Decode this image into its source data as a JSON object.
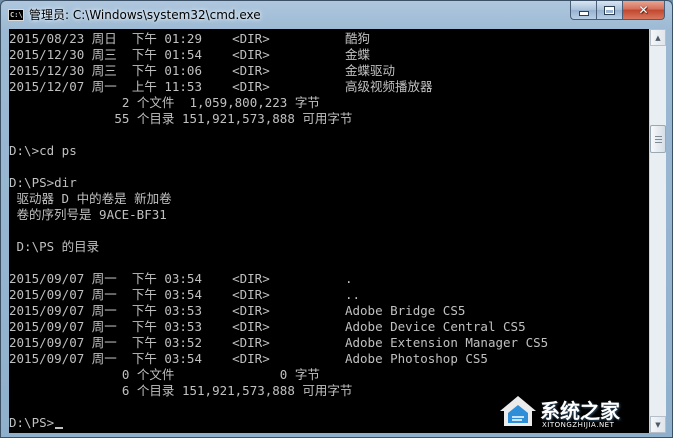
{
  "window": {
    "title": "管理员: C:\\Windows\\system32\\cmd.exe",
    "icon_label": "C:\\",
    "buttons": {
      "minimize": "minimize-icon",
      "maximize": "maximize-icon",
      "close": "close-icon",
      "close_glyph": "✕"
    }
  },
  "console": {
    "lines": [
      "2015/08/23 周日  下午 01:29    <DIR>          酷狗",
      "2015/12/30 周三  下午 01:54    <DIR>          金蝶",
      "2015/12/30 周三  下午 01:06    <DIR>          金蝶驱动",
      "2015/12/07 周一  上午 11:53    <DIR>          高级视频播放器",
      "               2 个文件  1,059,800,223 字节",
      "              55 个目录 151,921,573,888 可用字节",
      "",
      "D:\\>cd ps",
      "",
      "D:\\PS>dir",
      " 驱动器 D 中的卷是 新加卷",
      " 卷的序列号是 9ACE-BF31",
      "",
      " D:\\PS 的目录",
      "",
      "2015/09/07 周一  下午 03:54    <DIR>          .",
      "2015/09/07 周一  下午 03:54    <DIR>          ..",
      "2015/09/07 周一  下午 03:53    <DIR>          Adobe Bridge CS5",
      "2015/09/07 周一  下午 03:53    <DIR>          Adobe Device Central CS5",
      "2015/09/07 周一  下午 03:52    <DIR>          Adobe Extension Manager CS5",
      "2015/09/07 周一  下午 03:54    <DIR>          Adobe Photoshop CS5",
      "               0 个文件              0 字节",
      "               6 个目录 151,921,573,888 可用字节",
      "",
      "D:\\PS>"
    ]
  },
  "colors": {
    "console_background": "#000000",
    "console_text": "#c0c0c0",
    "titlebar": "#9cb9d3",
    "close_button": "#c2462f"
  },
  "watermark": {
    "text": "系统之家",
    "url": "XITONGZHIJIA.NET"
  }
}
